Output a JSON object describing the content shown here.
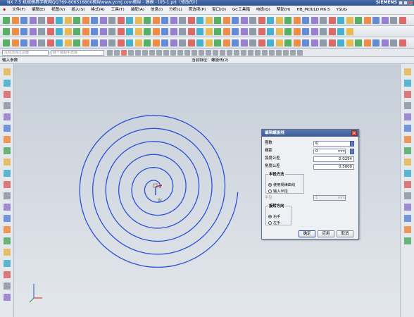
{
  "window": {
    "title": "NX 7.5 机械模具学教网QQ769-806516800教程www.ycmj.com教程 - 建模 - [05-1.prt（修改的）]",
    "brand": "SIEMENS"
  },
  "menu": [
    "文件(F)",
    "编辑(E)",
    "视图(V)",
    "插入(S)",
    "格式(R)",
    "工具(T)",
    "装配(A)",
    "信息(I)",
    "分析(L)",
    "首选项(P)",
    "窗口(O)",
    "GC工具箱",
    "电极(Q)",
    "帮助(H)",
    "HB_MOULD M6.5",
    "YSUG"
  ],
  "selection": {
    "filter": "没有选择过滤器",
    "scope": "整个装配中选择"
  },
  "status": {
    "prompt": "输入参数",
    "feature": "当前特征：螺旋线(2)"
  },
  "canvas": {
    "wcs_label": "ZC",
    "spiral_color": "#2b4fd6"
  },
  "dialog": {
    "title": "编辑螺旋线",
    "turns_label": "圈数",
    "turns_value": "6",
    "pitch_label": "螺距",
    "pitch_value": "0",
    "pitch_unit": "mm",
    "arc_tol_label": "弧度公差",
    "arc_tol_value": "0.0254",
    "angle_tol_label": "角度公差",
    "angle_tol_value": "0.5000",
    "radius_method": {
      "legend": "半径方法",
      "options": [
        "使用规律曲线",
        "输入半径"
      ],
      "selected": 0
    },
    "radius_label": "半径",
    "radius_value": "1",
    "radius_unit": "mm",
    "rotation": {
      "legend": "旋转方向",
      "options": [
        "右手",
        "左手"
      ],
      "selected": 0
    },
    "ok": "确定",
    "apply": "应用",
    "cancel": "取消"
  }
}
